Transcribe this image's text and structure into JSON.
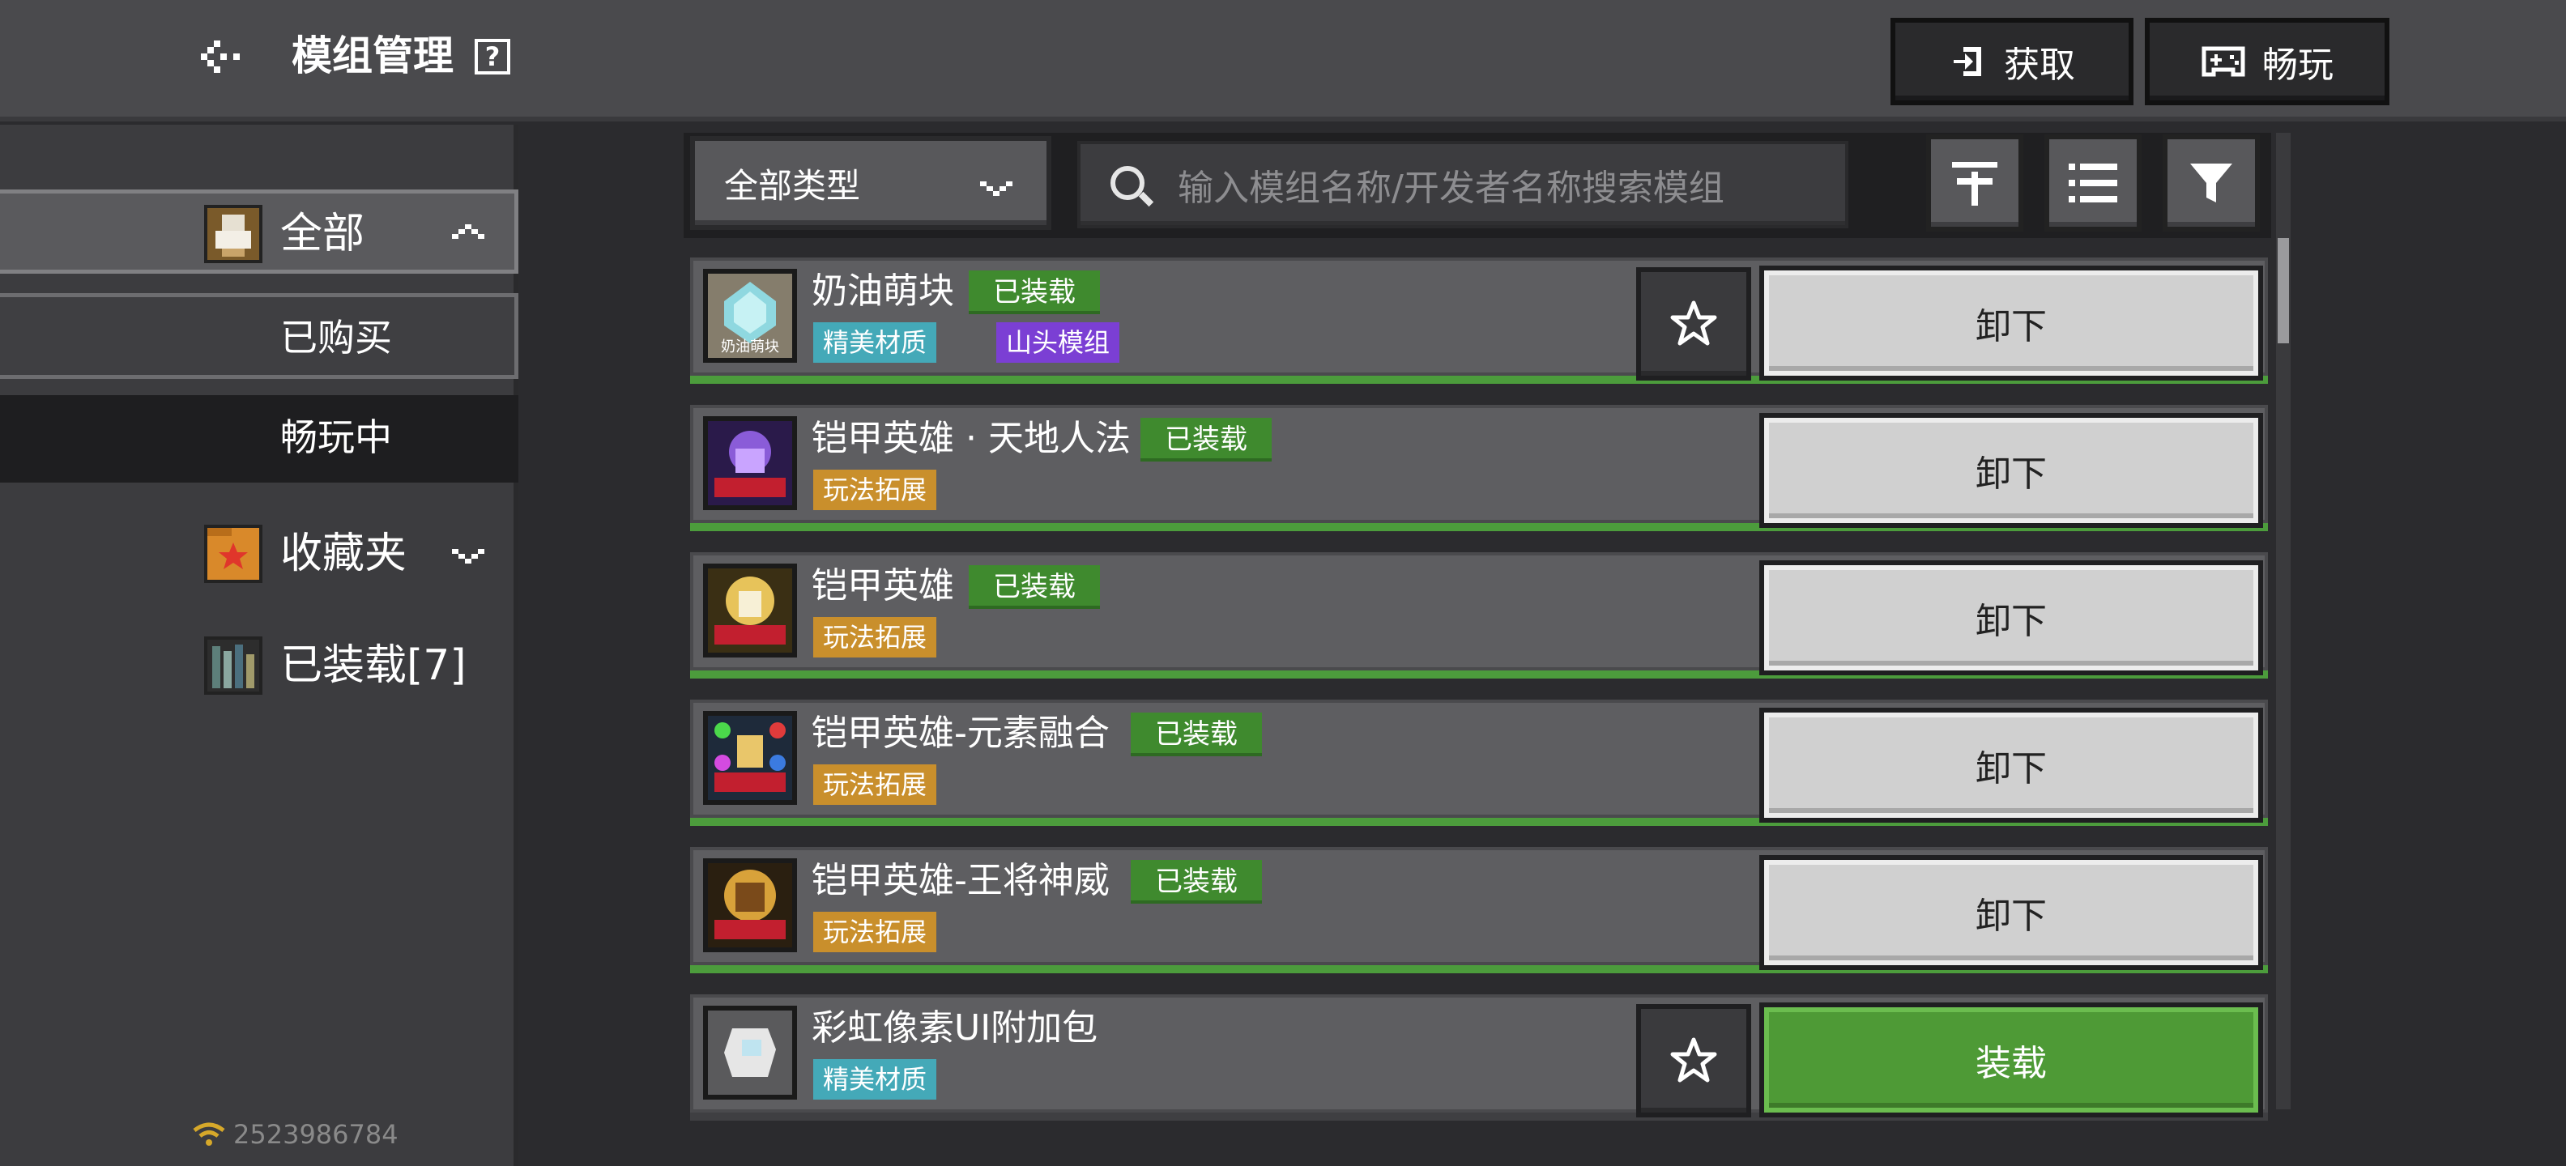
{
  "header": {
    "title": "模组管理",
    "help": "?",
    "get_label": "获取",
    "play_label": "畅玩"
  },
  "sidebar": {
    "all_label": "全部",
    "bought_label": "已购买",
    "playing_label": "畅玩中",
    "favorites_label": "收藏夹",
    "installed_label": "已装载[7]",
    "status_id": "2523986784"
  },
  "toolbar": {
    "type_dropdown": "全部类型",
    "search_placeholder": "输入模组名称/开发者名称搜索模组"
  },
  "mods": [
    {
      "name": "奶油萌块",
      "status": "已装载",
      "tags": [
        "精美材质",
        "山头模组"
      ],
      "action": "卸下",
      "has_star": true,
      "thumb_text": "奶油萌块"
    },
    {
      "name": "铠甲英雄 · 天地人法",
      "status": "已装载",
      "tags": [
        "玩法拓展"
      ],
      "action": "卸下",
      "has_star": false
    },
    {
      "name": "铠甲英雄",
      "status": "已装载",
      "tags": [
        "玩法拓展"
      ],
      "action": "卸下",
      "has_star": false
    },
    {
      "name": "铠甲英雄-元素融合",
      "status": "已装载",
      "tags": [
        "玩法拓展"
      ],
      "action": "卸下",
      "has_star": false
    },
    {
      "name": "铠甲英雄-王将神威",
      "status": "已装载",
      "tags": [
        "玩法拓展"
      ],
      "action": "卸下",
      "has_star": false
    },
    {
      "name": "彩虹像素UI附加包",
      "status": "",
      "tags": [
        "精美材质"
      ],
      "action": "装载",
      "has_star": true
    }
  ],
  "colors": {
    "installed_green": "#3f8a2e",
    "tag_teal": "#44a9b8",
    "tag_purple": "#7b3fd4",
    "tag_gold": "#c98f2c",
    "load_button": "#4e9a36"
  }
}
